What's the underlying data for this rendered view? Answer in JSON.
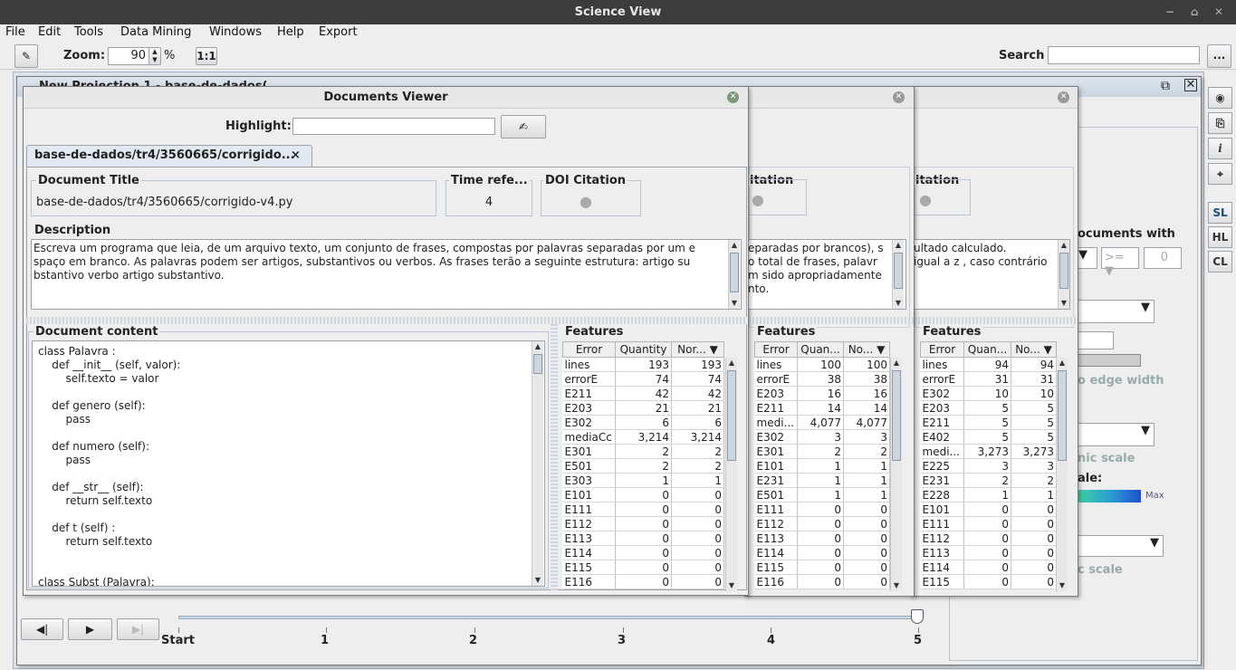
{
  "window": {
    "title": "Science View"
  },
  "menubar": {
    "items": [
      "File",
      "Edit",
      "Tools",
      "Data Mining",
      "Windows",
      "Help",
      "Export"
    ]
  },
  "toolbar": {
    "zoom_label": "Zoom:",
    "zoom_value": "90",
    "zoom_unit": "%",
    "one_to_one": "1:1",
    "search_label": "Search",
    "search_value": "",
    "more_button": "..."
  },
  "projection": {
    "title": "New Projection 1 - base-de-dados("
  },
  "viewer": {
    "title": "Documents Viewer",
    "highlight_label": "Highlight:",
    "highlight_value": "",
    "tab_label": "base-de-dados/tr4/3560665/corrigido...",
    "tab_close": "×",
    "doc_title_label": "Document Title",
    "doc_title_value": "base-de-dados/tr4/3560665/corrigido-v4.py",
    "time_ref_label": "Time refe...",
    "time_ref_value": "4",
    "doi_label": "DOI Citation",
    "description_label": "Description",
    "description_text": "Escreva um programa que leia, de um arquivo texto, um conjunto de frases, compostas por palavras separadas por um e spaço em branco. As palavras podem ser artigos, substantivos ou verbos. As frases terão a seguinte estrutura: artigo su bstantivo verbo artigo substantivo.",
    "content_label": "Document content",
    "content_lines": [
      "class Palavra :",
      "    def __init__ (self, valor):",
      "        self.texto = valor",
      "",
      "    def genero (self):",
      "        pass",
      "",
      "    def numero (self):",
      "        pass",
      "",
      "    def __str__ (self):",
      "        return self.texto",
      "",
      "    def t (self) :",
      "        return self.texto",
      "",
      "",
      "class Subst (Palavra):"
    ],
    "features_label": "Features",
    "features_columns": [
      "Error",
      "Quantity",
      "Nor..."
    ],
    "features_rows": [
      [
        "lines",
        "193",
        "193"
      ],
      [
        "errorE",
        "74",
        "74"
      ],
      [
        "E211",
        "42",
        "42"
      ],
      [
        "E203",
        "21",
        "21"
      ],
      [
        "E302",
        "6",
        "6"
      ],
      [
        "mediaCc",
        "3,214",
        "3,214"
      ],
      [
        "E301",
        "2",
        "2"
      ],
      [
        "E501",
        "2",
        "2"
      ],
      [
        "E303",
        "1",
        "1"
      ],
      [
        "E101",
        "0",
        "0"
      ],
      [
        "E111",
        "0",
        "0"
      ],
      [
        "E112",
        "0",
        "0"
      ],
      [
        "E113",
        "0",
        "0"
      ],
      [
        "E114",
        "0",
        "0"
      ],
      [
        "E115",
        "0",
        "0"
      ],
      [
        "E116",
        "0",
        "0"
      ]
    ]
  },
  "viewer2": {
    "doi_label": "itation",
    "description_text": "eparadas por brancos), s\no total de frases, palavr\nm sido apropriadamente\nnto.",
    "features_label": "Features",
    "features_columns": [
      "Error",
      "Quan...",
      "No..."
    ],
    "features_rows": [
      [
        "lines",
        "100",
        "100"
      ],
      [
        "errorE",
        "38",
        "38"
      ],
      [
        "E203",
        "16",
        "16"
      ],
      [
        "E211",
        "14",
        "14"
      ],
      [
        "medi...",
        "4,077",
        "4,077"
      ],
      [
        "E302",
        "3",
        "3"
      ],
      [
        "E301",
        "2",
        "2"
      ],
      [
        "E101",
        "1",
        "1"
      ],
      [
        "E231",
        "1",
        "1"
      ],
      [
        "E501",
        "1",
        "1"
      ],
      [
        "E111",
        "0",
        "0"
      ],
      [
        "E112",
        "0",
        "0"
      ],
      [
        "E113",
        "0",
        "0"
      ],
      [
        "E114",
        "0",
        "0"
      ],
      [
        "E115",
        "0",
        "0"
      ],
      [
        "E116",
        "0",
        "0"
      ]
    ]
  },
  "viewer3": {
    "doi_label": "itation",
    "description_text": "ultado calculado.\nigual a z , caso contrário",
    "features_label": "Features",
    "features_columns": [
      "Error",
      "Quan...",
      "No..."
    ],
    "features_rows": [
      [
        "lines",
        "94",
        "94"
      ],
      [
        "errorE",
        "31",
        "31"
      ],
      [
        "E302",
        "10",
        "10"
      ],
      [
        "E203",
        "5",
        "5"
      ],
      [
        "E211",
        "5",
        "5"
      ],
      [
        "E402",
        "5",
        "5"
      ],
      [
        "medi...",
        "3,273",
        "3,273"
      ],
      [
        "E225",
        "3",
        "3"
      ],
      [
        "E231",
        "2",
        "2"
      ],
      [
        "E228",
        "1",
        "1"
      ],
      [
        "E101",
        "0",
        "0"
      ],
      [
        "E111",
        "0",
        "0"
      ],
      [
        "E112",
        "0",
        "0"
      ],
      [
        "E113",
        "0",
        "0"
      ],
      [
        "E114",
        "0",
        "0"
      ],
      [
        "E115",
        "0",
        "0"
      ]
    ]
  },
  "right_panel": {
    "documents_with": "ocuments with",
    "operator": ">=",
    "number": "0",
    "edge_width": "o edge width",
    "dynamic_scale": "nic scale",
    "scale_label": "ale:",
    "max_label": "Max",
    "c_scale": "c scale"
  },
  "side_buttons": [
    "SL",
    "HL",
    "CL"
  ],
  "timeline": {
    "labels": [
      "Start",
      "1",
      "2",
      "3",
      "4",
      "5"
    ]
  }
}
